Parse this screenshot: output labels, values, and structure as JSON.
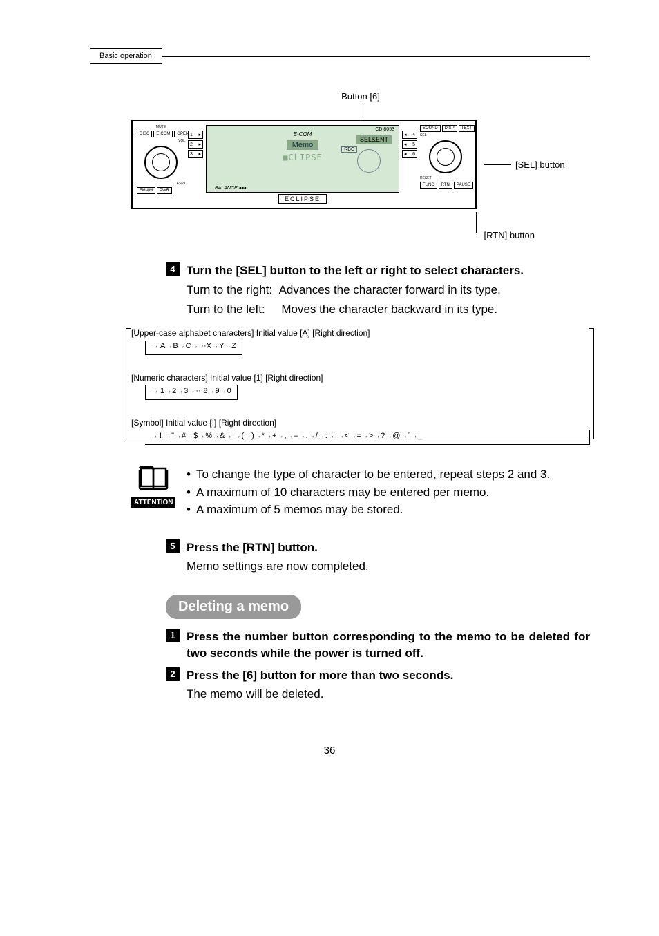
{
  "header": {
    "tab": "Basic operation"
  },
  "callouts": {
    "button6": "Button [6]",
    "sel": "[SEL] button",
    "rtn": "[RTN] button"
  },
  "device": {
    "brand": "E-COM",
    "memo": "Memo",
    "eclipse_txt": "■CLIPSE",
    "selent": "SEL&ENT",
    "rbc": "RBC",
    "balance": "BALANCE",
    "cd8053": "CD 8053",
    "eclipse_logo": "ECLIPSE",
    "top_left": [
      "DISC",
      "E·COM",
      "OPEN"
    ],
    "top_right": [
      "SOUND",
      "DISP",
      "TEXT"
    ],
    "bot_left": [
      "FM AM",
      "PWR"
    ],
    "bot_right": [
      "FUNC",
      "RTN",
      "PAUSE"
    ],
    "vol": "VOL",
    "sel": "SEL",
    "espii": "ESPii",
    "reset": "RESET",
    "mute": "MUTE",
    "presets_left": [
      "1",
      "2",
      "3"
    ],
    "presets_right": [
      "4",
      "5",
      "6"
    ]
  },
  "step4": {
    "num": "4",
    "title": "Turn the [SEL] button to the left or right to select characters.",
    "line1_label": "Turn to the right:",
    "line1_text": "Advances the character forward in its type.",
    "line2_label": "Turn to the left:",
    "line2_text": "Moves the character backward in its type."
  },
  "char_upper": {
    "label": "[Upper-case alphabet characters] Initial value [A]     [Right direction]",
    "seq": "A→B→C→···X→Y→Z"
  },
  "char_numeric": {
    "label": "[Numeric characters] Initial value [1]     [Right direction]",
    "seq": "1→2→3→···8→9→0"
  },
  "char_symbol": {
    "label": "[Symbol] Initial value [!]     [Right direction]",
    "seq": "! →\"→#→$→%→&→'→(→)→*→+→,→–→.→/→:→;→<→=→>→?→@→´→_"
  },
  "attention": {
    "label": "ATTENTION",
    "item1": "To change the type of character to be entered, repeat steps 2 and 3.",
    "item2": "A maximum of 10 characters may be entered per memo.",
    "item3": "A maximum of 5 memos may be stored."
  },
  "step5": {
    "num": "5",
    "title": "Press the [RTN] button.",
    "text": "Memo settings are now completed."
  },
  "deleting": {
    "heading": "Deleting a memo",
    "step1_num": "1",
    "step1_title": "Press the number button corresponding to the memo to be deleted for two seconds while the power is turned off.",
    "step2_num": "2",
    "step2_title": "Press the [6] button for more than two seconds.",
    "step2_text": "The memo will be deleted."
  },
  "page_num": "36"
}
